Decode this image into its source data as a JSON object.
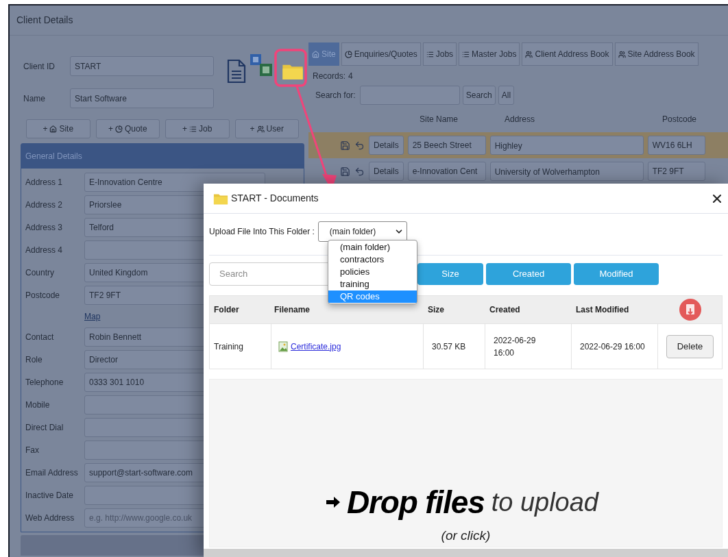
{
  "panel_title": "Client Details",
  "client_fields": [
    {
      "label": "Client ID",
      "value": "START"
    },
    {
      "label": "Name",
      "value": "Start Software"
    }
  ],
  "add_buttons": [
    {
      "sign": "+",
      "label": "Site"
    },
    {
      "sign": "+",
      "label": "Quote"
    },
    {
      "sign": "+",
      "label": "Job"
    },
    {
      "sign": "+",
      "label": "User"
    }
  ],
  "general_details": {
    "title": "General Details",
    "rows": [
      {
        "label": "Address 1",
        "value": "E-Innovation  Centre"
      },
      {
        "label": "Address 2",
        "value": "Priorslee"
      },
      {
        "label": "Address 3",
        "value": "Telford"
      },
      {
        "label": "Address 4",
        "value": ""
      },
      {
        "label": "Country",
        "value": "United Kingdom"
      },
      {
        "label": "Postcode",
        "value": "TF2 9FT"
      },
      {
        "kind": "link",
        "label": "Map"
      },
      {
        "label": "Contact",
        "value": "Robin Bennett"
      },
      {
        "label": "Role",
        "value": "Director"
      },
      {
        "label": "Telephone",
        "value": "0333 301 1010"
      },
      {
        "label": "Mobile",
        "value": ""
      },
      {
        "label": "Direct Dial",
        "value": ""
      },
      {
        "label": "Fax",
        "value": ""
      },
      {
        "label": "Email Address",
        "value": "support@start-software.com"
      },
      {
        "label": "Inactive Date",
        "value": ""
      },
      {
        "label": "Web Address",
        "placeholder": "e.g. http://www.google.co.uk"
      }
    ]
  },
  "tabs": [
    {
      "label": "Site",
      "selected": true
    },
    {
      "label": "Enquiries/Quotes",
      "selected": false
    },
    {
      "label": "Jobs",
      "selected": false
    },
    {
      "label": "Master Jobs",
      "selected": false
    },
    {
      "label": "Client Address Book",
      "selected": false
    },
    {
      "label": "Site Address Book",
      "selected": false
    }
  ],
  "records": {
    "label": "Records:",
    "count": "4"
  },
  "site_search": {
    "label": "Search for:",
    "buttons": [
      "Search",
      "All"
    ]
  },
  "site_table": {
    "columns": [
      "Site Name",
      "Address",
      "Postcode"
    ],
    "rows": [
      {
        "details": "Details",
        "site_name": "25 Beech Street",
        "address": "Highley",
        "postcode": "WV16 6LH",
        "selected": true
      },
      {
        "details": "Details",
        "site_name": "e-Innovation Cent",
        "address": "University of Wolverhampton",
        "postcode": "TF2 9FT",
        "selected": false
      }
    ]
  },
  "modal": {
    "title": "START - Documents",
    "upload_label": "Upload File Into This Folder :",
    "folder_select": {
      "value": "(main folder)",
      "expanded": true,
      "options": [
        {
          "label": "(main folder)",
          "highlighted": false
        },
        {
          "label": "contractors",
          "highlighted": false
        },
        {
          "label": "policies",
          "highlighted": false
        },
        {
          "label": "training",
          "highlighted": false
        },
        {
          "label": "QR codes",
          "highlighted": true
        }
      ]
    },
    "search_placeholder": "Search",
    "sort_buttons": [
      "Size",
      "Created",
      "Modified"
    ],
    "columns": [
      "Folder",
      "Filename",
      "Size",
      "Created",
      "Last Modified"
    ],
    "rows": [
      {
        "folder": "Training",
        "filename": "Certificate.jpg",
        "size": "30.57 KB",
        "created": "2022-06-29 16:00",
        "modified": "2022-06-29 16:00",
        "action": "Delete"
      }
    ],
    "dropzone": {
      "bold": "Drop files",
      "light": "to upload",
      "hint": "(or click)"
    }
  }
}
